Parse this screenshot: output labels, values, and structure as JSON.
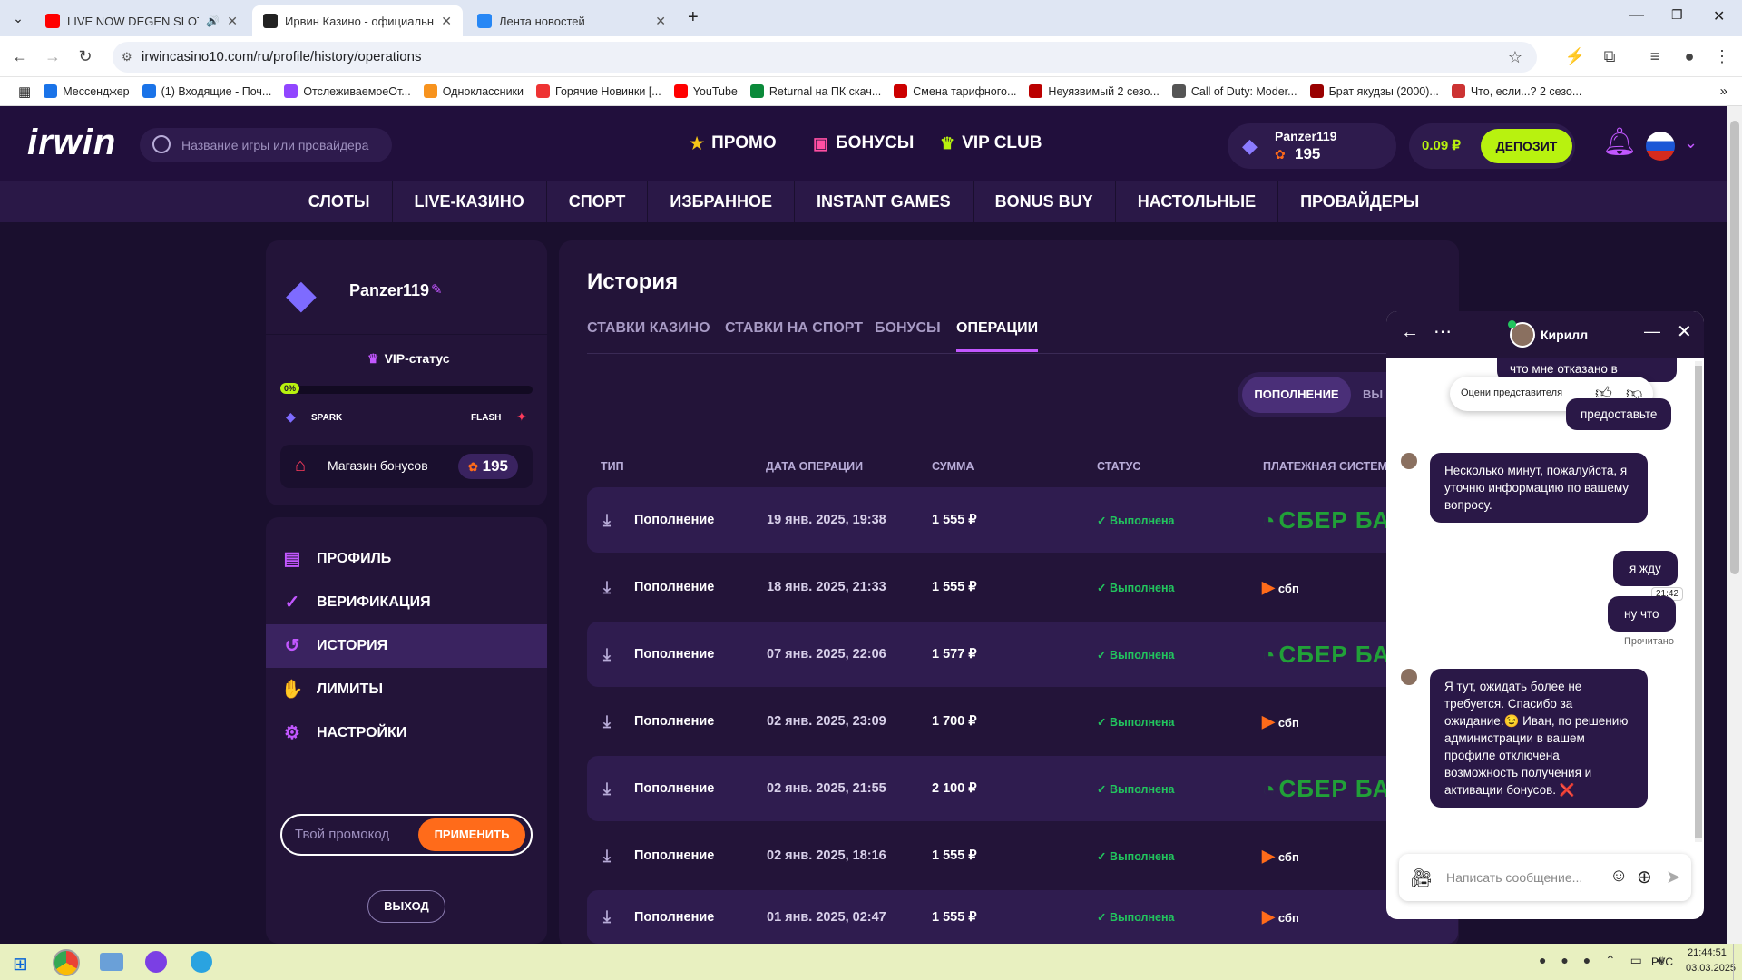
{
  "browser": {
    "tabs": [
      {
        "title": "LIVE NOW DEGEN SLOTS",
        "active": false,
        "color": "#ff0000"
      },
      {
        "title": "Ирвин Казино - официальный",
        "active": true,
        "color": "#222222"
      },
      {
        "title": "Лента новостей",
        "active": false,
        "color": "#2787f5"
      }
    ],
    "url": "irwincasino10.com/ru/profile/history/operations",
    "bookmarks": [
      {
        "label": "Мессенджер",
        "color": "#1a73e8"
      },
      {
        "label": "(1) Входящие - Поч...",
        "color": "#1a73e8"
      },
      {
        "label": "ОтслеживаемоеОт...",
        "color": "#9146ff"
      },
      {
        "label": "Одноклассники",
        "color": "#f7931e"
      },
      {
        "label": "Горячие Новинки [...",
        "color": "#e33"
      },
      {
        "label": "YouTube",
        "color": "#ff0000"
      },
      {
        "label": "Returnal на ПК скач...",
        "color": "#0a8a3a"
      },
      {
        "label": "Смена тарифного...",
        "color": "#c00"
      },
      {
        "label": "Неуязвимый 2 сезо...",
        "color": "#b00"
      },
      {
        "label": "Call of Duty: Moder...",
        "color": "#555"
      },
      {
        "label": "Брат якудзы (2000)...",
        "color": "#900"
      },
      {
        "label": "Что, если...? 2 сезо...",
        "color": "#c33"
      }
    ]
  },
  "site": {
    "logo": "irwin",
    "search_placeholder": "Название игры или провайдера",
    "nav": [
      {
        "label": "ПРОМО",
        "icon": "★"
      },
      {
        "label": "БОНУСЫ",
        "icon": "🎁"
      },
      {
        "label": "VIP CLUB",
        "icon": "♛"
      }
    ],
    "user": {
      "name": "Panzer119",
      "points": "195"
    },
    "balance": "0.09 ₽",
    "deposit_label": "ДЕПОЗИТ",
    "categories": [
      "СЛОТЫ",
      "LIVE-КАЗИНО",
      "СПОРТ",
      "ИЗБРАННОЕ",
      "INSTANT GAMES",
      "BONUS BUY",
      "НАСТОЛЬНЫЕ",
      "ПРОВАЙДЕРЫ"
    ],
    "colors": {
      "accent": "#b8f20f",
      "purple": "#c257ff",
      "bg": "#1a0f2e"
    }
  },
  "profile": {
    "username": "Panzer119",
    "vip_label": "VIP-статус",
    "progress_label": "0%",
    "progress": 0,
    "level_from": "SPARK",
    "level_to": "FLASH",
    "shop_label": "Магазин бонусов",
    "shop_points": "195"
  },
  "menu": [
    {
      "label": "ПРОФИЛЬ",
      "icon": "▤",
      "active": false
    },
    {
      "label": "ВЕРИФИКАЦИЯ",
      "icon": "✓",
      "active": false
    },
    {
      "label": "ИСТОРИЯ",
      "icon": "↺",
      "active": true
    },
    {
      "label": "ЛИМИТЫ",
      "icon": "✋",
      "active": false
    },
    {
      "label": "НАСТРОЙКИ",
      "icon": "⚙",
      "active": false
    }
  ],
  "promo": {
    "placeholder": "Твой промокод",
    "apply_label": "ПРИМЕНИТЬ"
  },
  "logout_label": "ВЫХОД",
  "history": {
    "title": "История",
    "tabs": [
      "СТАВКИ КАЗИНО",
      "СТАВКИ НА СПОРТ",
      "БОНУСЫ",
      "ОПЕРАЦИИ"
    ],
    "toggle": [
      "ПОПОЛНЕНИЕ",
      "ВЫ"
    ],
    "columns": [
      "ТИП",
      "ДАТА ОПЕРАЦИИ",
      "СУММА",
      "СТАТУС",
      "ПЛАТЕЖНАЯ СИСТЕМ"
    ],
    "rows": [
      {
        "type": "Пополнение",
        "date": "19 янв. 2025, 19:38",
        "amount": "1 555 ₽",
        "status": "Выполнена",
        "system": "СБЕР БАНК",
        "kind": "sber"
      },
      {
        "type": "Пополнение",
        "date": "18 янв. 2025, 21:33",
        "amount": "1 555 ₽",
        "status": "Выполнена",
        "system": "сбп",
        "kind": "sbp"
      },
      {
        "type": "Пополнение",
        "date": "07 янв. 2025, 22:06",
        "amount": "1 577 ₽",
        "status": "Выполнена",
        "system": "СБЕР БАНК",
        "kind": "sber"
      },
      {
        "type": "Пополнение",
        "date": "02 янв. 2025, 23:09",
        "amount": "1 700 ₽",
        "status": "Выполнена",
        "system": "сбп",
        "kind": "sbp"
      },
      {
        "type": "Пополнение",
        "date": "02 янв. 2025, 21:55",
        "amount": "2 100 ₽",
        "status": "Выполнена",
        "system": "СБЕР БАНК",
        "kind": "sber"
      },
      {
        "type": "Пополнение",
        "date": "02 янв. 2025, 18:16",
        "amount": "1 555 ₽",
        "status": "Выполнена",
        "system": "сбп",
        "kind": "sbp"
      },
      {
        "type": "Пополнение",
        "date": "01 янв. 2025, 02:47",
        "amount": "1 555 ₽",
        "status": "Выполнена",
        "system": "сбп",
        "kind": "sbp"
      }
    ]
  },
  "chat": {
    "agent_name": "Кирилл",
    "rate_label": "Оцени представителя",
    "messages": [
      {
        "from": "user",
        "text": "что мне отказано в бонусах"
      },
      {
        "from": "user",
        "text": "предоставьте"
      },
      {
        "from": "agent",
        "text": "Несколько минут, пожалуйста, я уточню информацию по вашему вопросу."
      },
      {
        "from": "user",
        "text": "я жду",
        "time": "21:42"
      },
      {
        "from": "user",
        "text": "ну что"
      },
      {
        "from": "agent",
        "text": "Я тут, ожидать более не требуется. Спасибо за ожидание.😉 Иван, по решению администрации в вашем профиле отключена возможность получения и активации бонусов. ❌"
      }
    ],
    "read_label": "Прочитано",
    "input_placeholder": "Написать сообщение..."
  },
  "taskbar": {
    "lang": "РУС",
    "time": "21:44:51",
    "date": "03.03.2025"
  }
}
